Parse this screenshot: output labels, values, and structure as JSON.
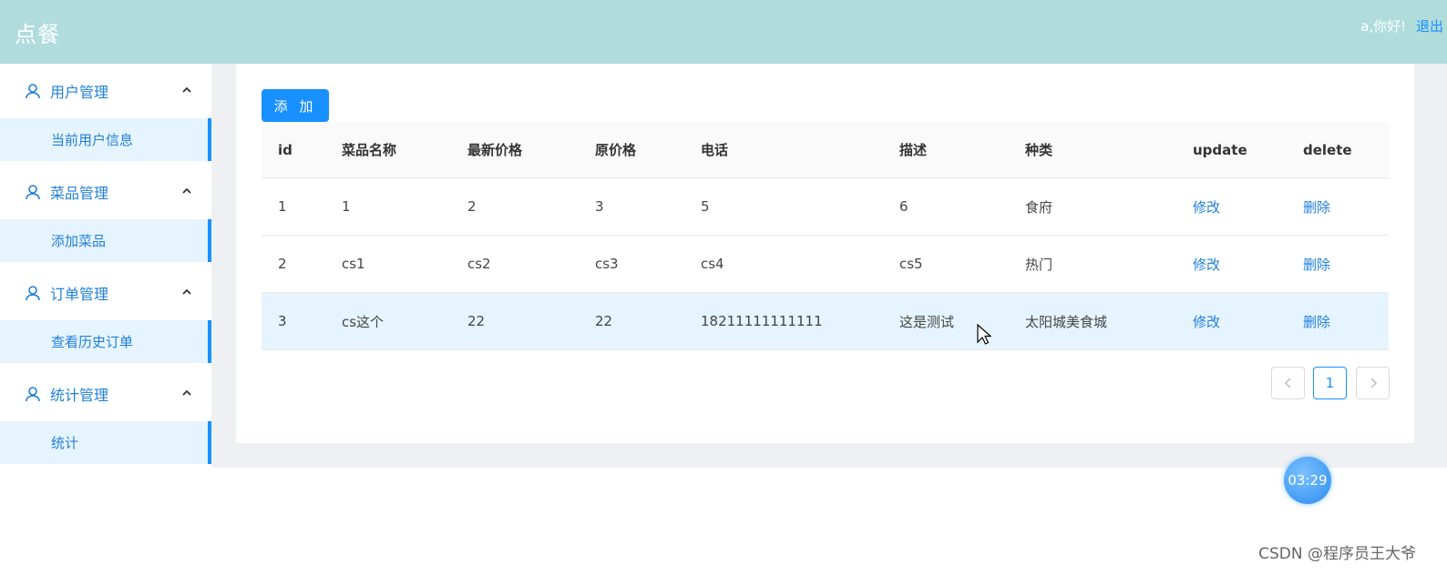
{
  "header": {
    "title": "点餐",
    "greeting": "a,你好!",
    "logout": "退出"
  },
  "sidebar": {
    "groups": [
      {
        "title": "用户管理",
        "items": [
          "当前用户信息"
        ]
      },
      {
        "title": "菜品管理",
        "items": [
          "添加菜品"
        ]
      },
      {
        "title": "订单管理",
        "items": [
          "查看历史订单"
        ]
      },
      {
        "title": "统计管理",
        "items": [
          "统计"
        ]
      }
    ]
  },
  "toolbar": {
    "add_label": "添 加"
  },
  "table": {
    "columns": [
      "id",
      "菜品名称",
      "最新价格",
      "原价格",
      "电话",
      "描述",
      "种类",
      "update",
      "delete"
    ],
    "rows": [
      {
        "id": "1",
        "name": "1",
        "new_price": "2",
        "orig_price": "3",
        "phone": "5",
        "desc": "6",
        "type": "食府",
        "update": "修改",
        "delete": "删除"
      },
      {
        "id": "2",
        "name": "cs1",
        "new_price": "cs2",
        "orig_price": "cs3",
        "phone": "cs4",
        "desc": "cs5",
        "type": "热门",
        "update": "修改",
        "delete": "删除"
      },
      {
        "id": "3",
        "name": "cs这个",
        "new_price": "22",
        "orig_price": "22",
        "phone": "18211111111111",
        "desc": "这是测试",
        "type": "太阳城美食城",
        "update": "修改",
        "delete": "删除"
      }
    ]
  },
  "pagination": {
    "prev": "<",
    "current": "1",
    "next": ">"
  },
  "timer": "03:29",
  "watermark": "CSDN @程序员王大爷",
  "colors": {
    "header": "#b0dcdc",
    "accent": "#1890ff",
    "highlight_row": "#e6f4ff"
  }
}
